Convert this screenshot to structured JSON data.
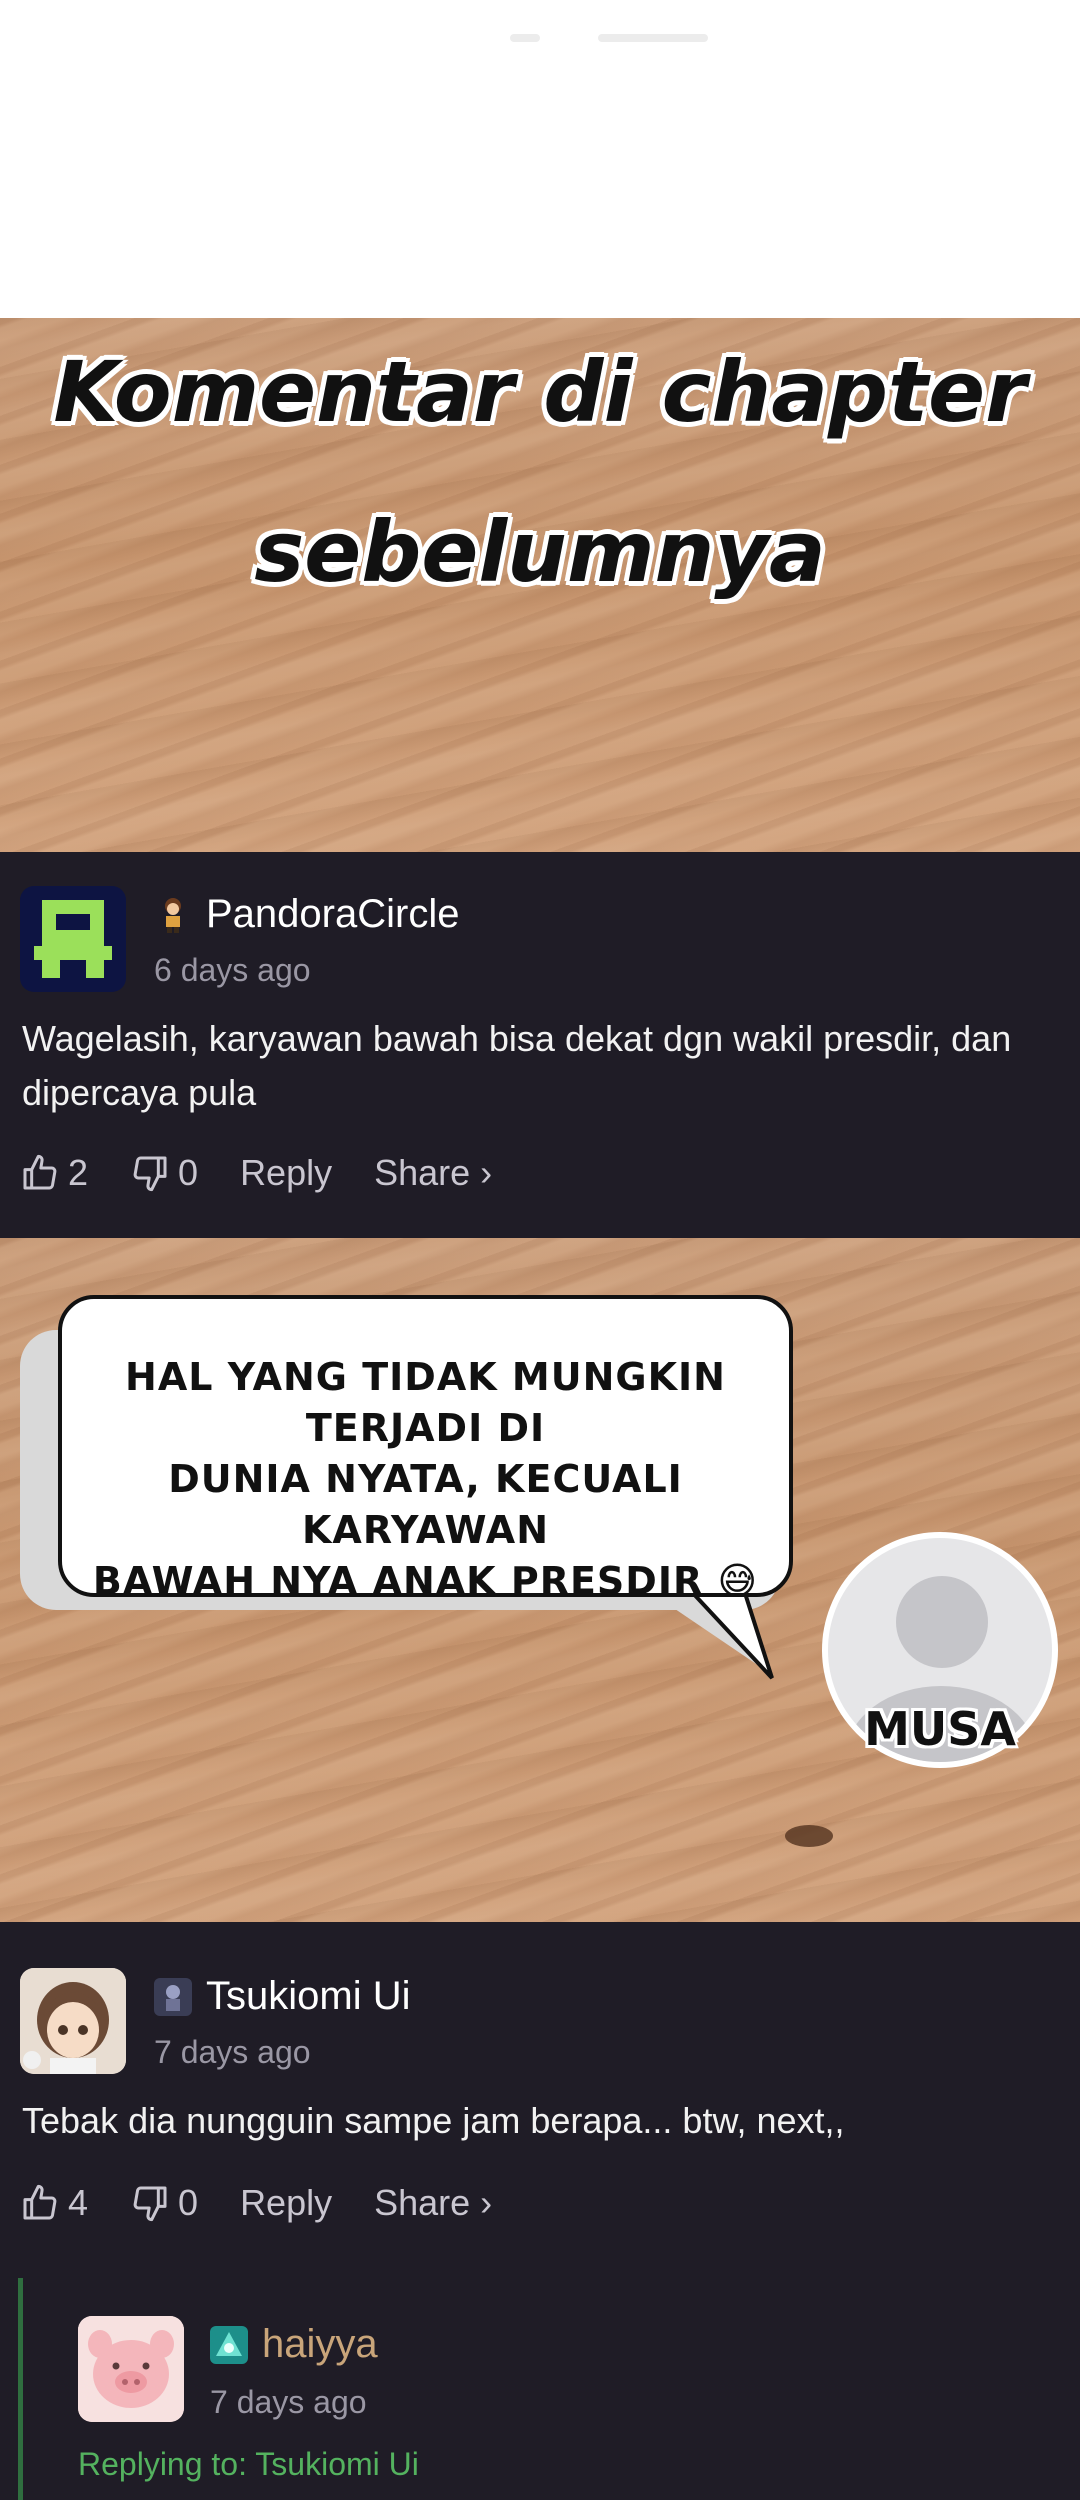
{
  "banner": {
    "line1": "Komentar di chapter",
    "line2": "sebelumnya"
  },
  "comments": [
    {
      "username": "PandoraCircle",
      "time": "6 days ago",
      "text": "Wagelasih, karyawan bawah bisa dekat dgn wakil presdir, dan dipercaya pula",
      "likes": "2",
      "dislikes": "0",
      "reply_label": "Reply",
      "share_label": "Share ›"
    },
    {
      "username": "Tsukiomi Ui",
      "time": "7 days ago",
      "text": "Tebak dia nungguin sampe jam berapa... btw, next,,",
      "likes": "4",
      "dislikes": "0",
      "reply_label": "Reply",
      "share_label": "Share ›"
    }
  ],
  "reply": {
    "username": "haiyya",
    "time": "7 days ago",
    "replying_to": "Replying to: Tsukiomi Ui"
  },
  "bubble": {
    "line1": "HAL YANG TIDAK MUNGKIN TERJADI DI",
    "line2": "DUNIA NYATA, KECUALI KARYAWAN",
    "line3": "BAWAH NYA ANAK PRESDIR 😅",
    "avatar_label": "MUSA"
  },
  "icons": {
    "like": "thumbs-up-icon",
    "dislike": "thumbs-down-icon"
  },
  "colors": {
    "comment_bg": "#1f1c26",
    "reply_green": "#54b25f",
    "reply_username": "#c9a57a",
    "pandora_avatar_bg": "#0d1442",
    "pandora_avatar_fg": "#9be05a"
  }
}
